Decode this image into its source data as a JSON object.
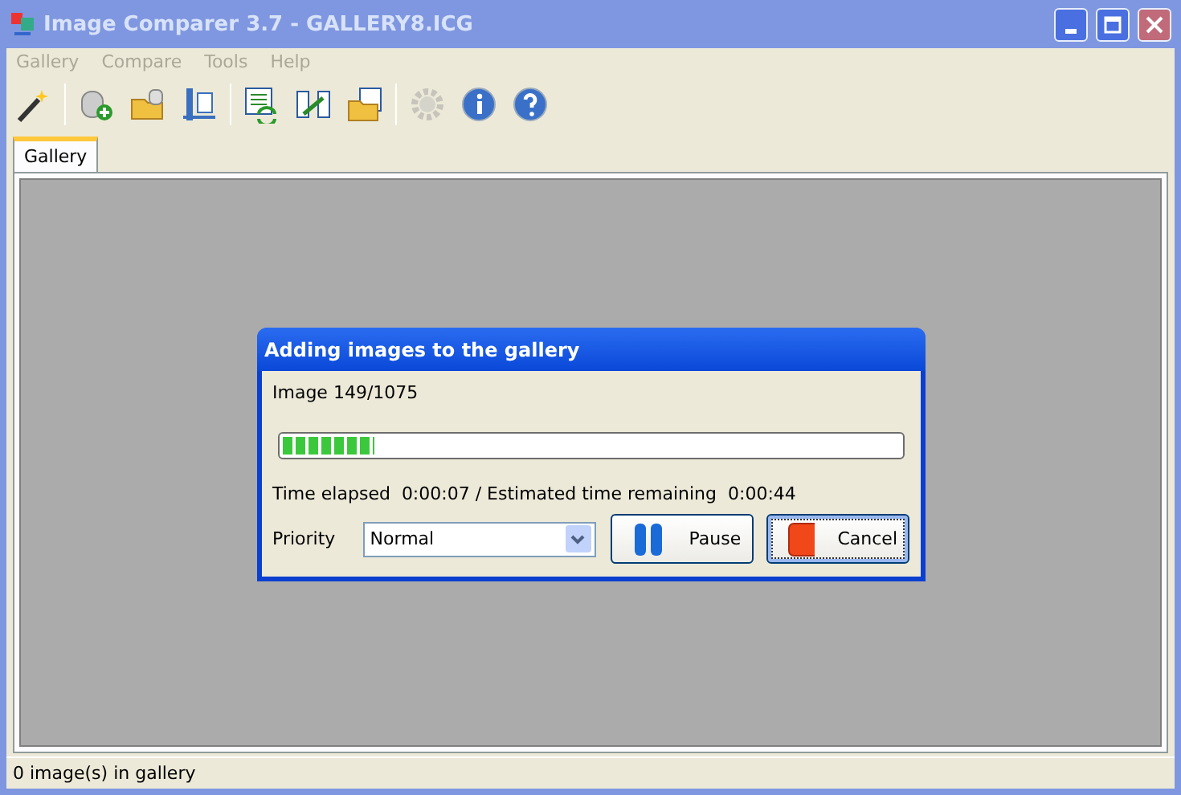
{
  "window": {
    "title": "Image Comparer 3.7 - GALLERY8.ICG",
    "active": false
  },
  "menu": [
    {
      "label": "Gallery",
      "disabled": true
    },
    {
      "label": "Compare",
      "disabled": true
    },
    {
      "label": "Tools",
      "disabled": true
    },
    {
      "label": "Help",
      "disabled": true
    }
  ],
  "toolbar": [
    {
      "kind": "wand",
      "disabled": false
    },
    {
      "kind": "separator"
    },
    {
      "kind": "add-database",
      "disabled": false
    },
    {
      "kind": "open-database",
      "disabled": false
    },
    {
      "kind": "compress",
      "disabled": false
    },
    {
      "kind": "separator"
    },
    {
      "kind": "refresh-list",
      "disabled": false
    },
    {
      "kind": "compare",
      "disabled": false
    },
    {
      "kind": "folder-list",
      "disabled": false
    },
    {
      "kind": "separator"
    },
    {
      "kind": "gear",
      "disabled": true
    },
    {
      "kind": "info",
      "disabled": false
    },
    {
      "kind": "help",
      "disabled": false
    }
  ],
  "tabs": [
    {
      "label": "Gallery",
      "selected": true
    }
  ],
  "dialog": {
    "title": "Adding images to the gallery",
    "counter": "Image 149/1075",
    "progress": {
      "level": 0.15
    },
    "time_text": "Time elapsed  0:00:07 / Estimated time remaining  0:00:44",
    "priority": {
      "label": "Priority",
      "value": "Normal"
    },
    "buttons": [
      {
        "kind": "pause",
        "label": "Pause",
        "focused": false
      },
      {
        "kind": "cancel",
        "label": "Cancel",
        "focused": true
      }
    ]
  },
  "status_bar": "0 image(s) in gallery"
}
